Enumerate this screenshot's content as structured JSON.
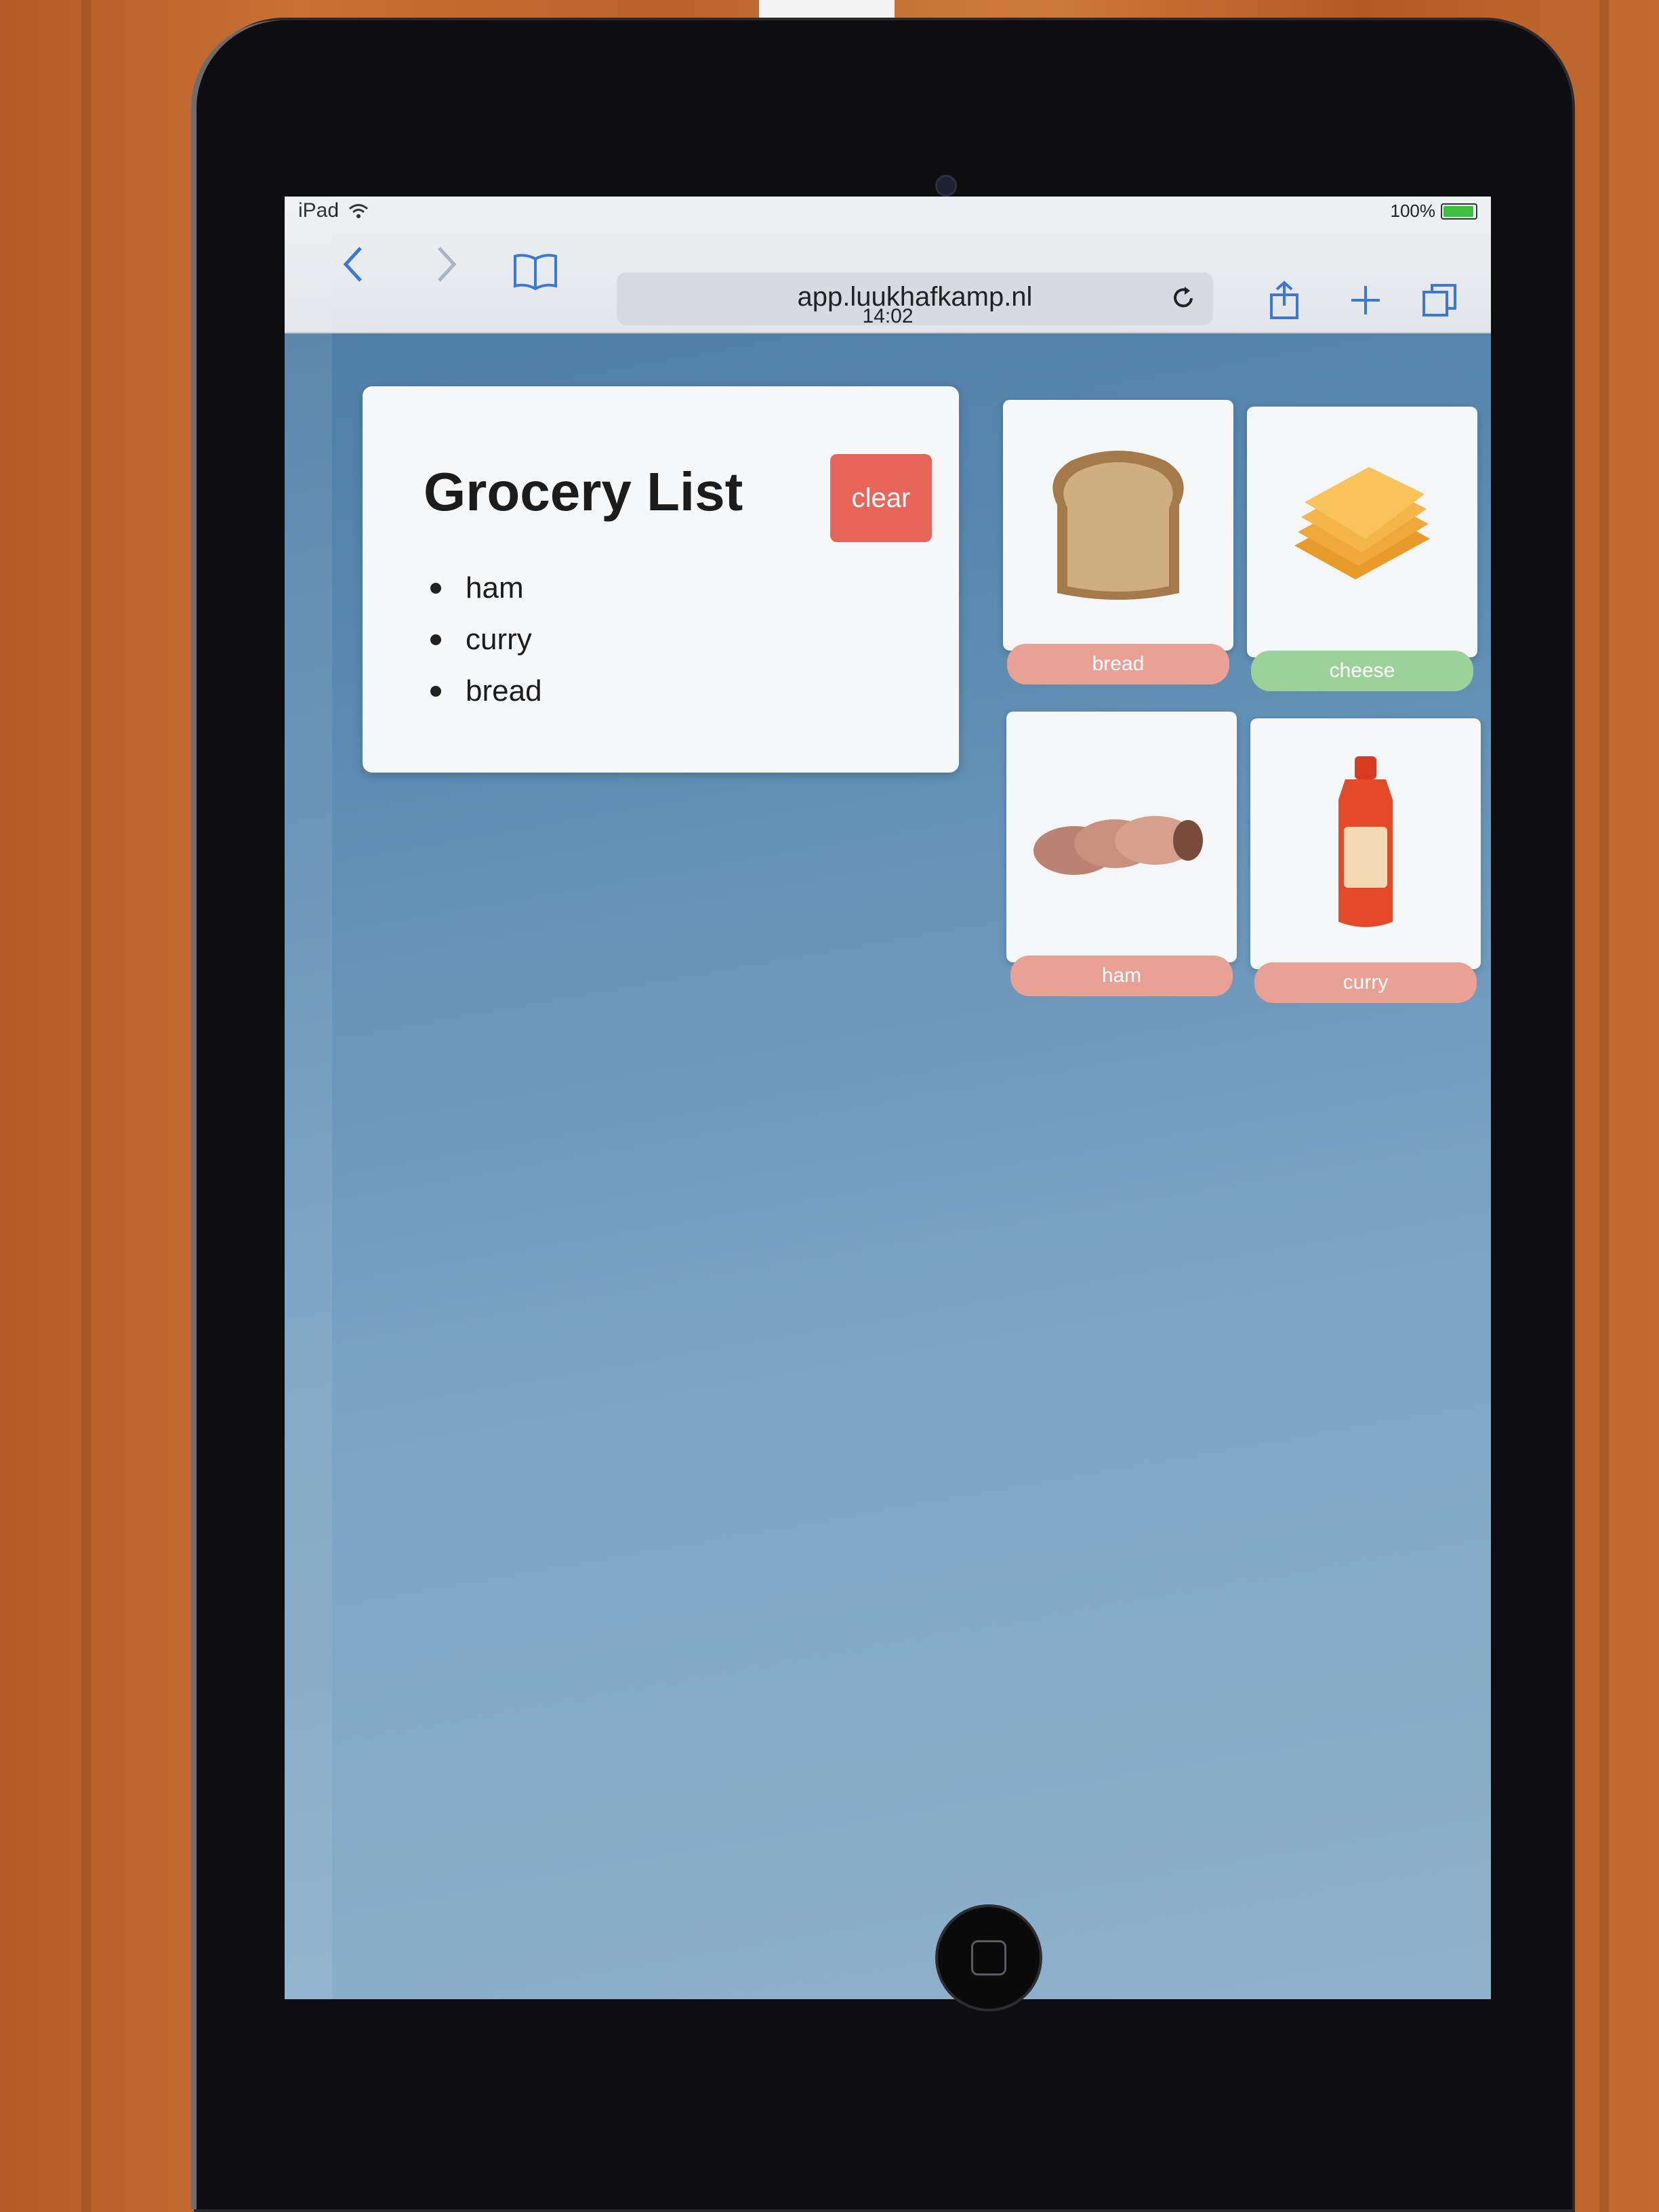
{
  "status_bar": {
    "device": "iPad",
    "time": "14:02",
    "battery": "100%",
    "battery_level": 1.0
  },
  "browser": {
    "url": "app.luukhafkamp.nl",
    "icons": [
      "back-icon",
      "forward-icon",
      "bookmarks-icon",
      "reload-icon",
      "share-icon",
      "new-tab-icon",
      "tabs-icon"
    ]
  },
  "grocery_card": {
    "title": "Grocery List",
    "clear_label": "clear",
    "clear_color": "#e8655a",
    "items": [
      "ham",
      "curry",
      "bread"
    ]
  },
  "products": [
    {
      "label": "bread",
      "in_list": true,
      "icon": "bread-slice-icon"
    },
    {
      "label": "cheese",
      "in_list": false,
      "icon": "cheese-slices-icon"
    },
    {
      "label": "ham",
      "in_list": true,
      "icon": "ham-rolls-icon"
    },
    {
      "label": "curry",
      "in_list": true,
      "icon": "curry-bottle-icon"
    }
  ],
  "colors": {
    "tile_button_off": "#e8a194",
    "tile_button_on": "#9cd19a",
    "page_background": "#5e8cb2"
  }
}
